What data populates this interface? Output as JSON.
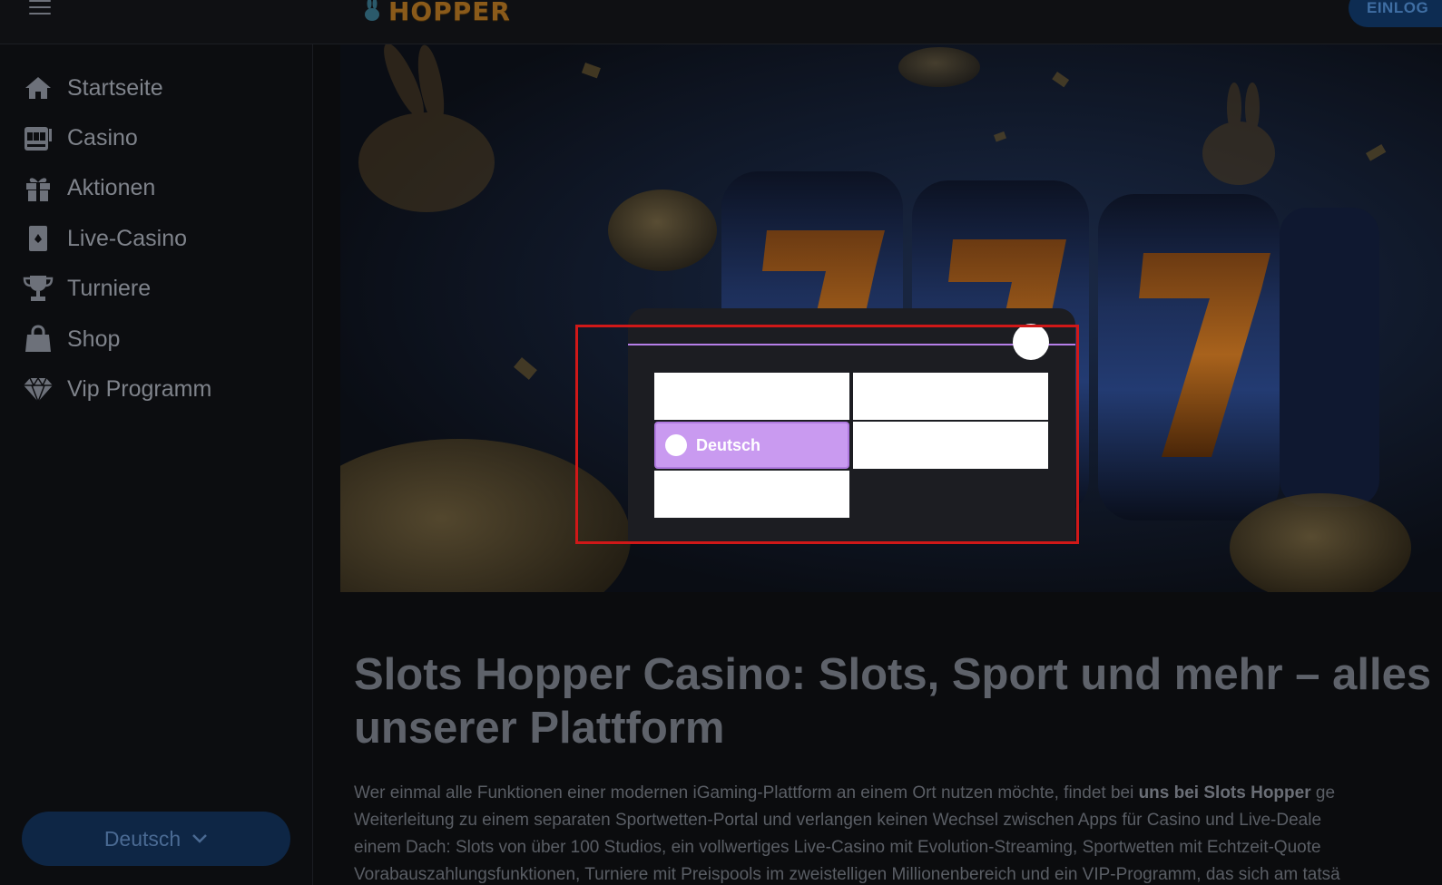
{
  "header": {
    "logo_text": "HOPPER",
    "login_label": "EINLOG",
    "menu_icon": "hamburger-icon"
  },
  "sidebar": {
    "items": [
      {
        "label": "Startseite",
        "icon": "home-icon"
      },
      {
        "label": "Casino",
        "icon": "slot-machine-icon"
      },
      {
        "label": "Aktionen",
        "icon": "gift-icon"
      },
      {
        "label": "Live-Casino",
        "icon": "playing-card-icon"
      },
      {
        "label": "Turniere",
        "icon": "trophy-icon"
      },
      {
        "label": "Shop",
        "icon": "shopping-bag-icon"
      },
      {
        "label": "Vip Programm",
        "icon": "diamond-icon"
      }
    ],
    "language_button": "Deutsch"
  },
  "main": {
    "title_line1": "Slots Hopper Casino: Slots, Sport und mehr – alles",
    "title_line2": "unserer Plattform",
    "paragraph": {
      "line1_start": "Wer einmal alle Funktionen einer modernen iGaming-Plattform an einem Ort nutzen möchte, findet bei ",
      "line1_bold": "uns bei Slots Hopper",
      "line1_end": " ge",
      "line2": "Weiterleitung zu einem separaten Sportwetten-Portal und verlangen keinen Wechsel zwischen Apps für Casino und Live-Deale",
      "line3": "einem Dach: Slots von über 100 Studios, ein vollwertiges Live-Casino mit Evolution-Streaming, Sportwetten mit Echtzeit-Quote",
      "line4": "Vorabauszahlungsfunktionen, Turniere mit Preispools im zweistelligen Millionenbereich und ein VIP-Programm, das sich am tatsä"
    }
  },
  "language_modal": {
    "selected_option": "Deutsch",
    "accent_color": "#c99af0"
  }
}
